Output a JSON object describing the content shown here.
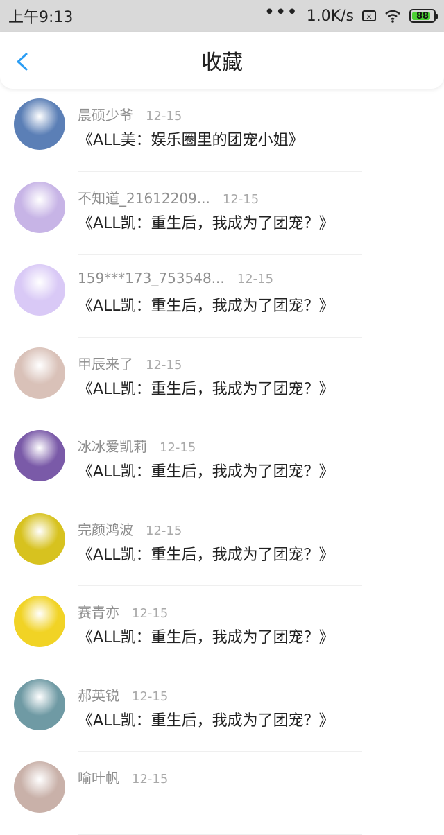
{
  "statusbar": {
    "time": "上午9:13",
    "dots": "•••",
    "speed": "1.0K/s",
    "battery": "88"
  },
  "header": {
    "title": "收藏"
  },
  "items": [
    {
      "name": "晨硕少爷",
      "date": "12-15",
      "book": "《ALL美：娱乐圈里的团宠小姐》",
      "avatar_color": "#5b7fb6"
    },
    {
      "name": "不知道_21612209...",
      "date": "12-15",
      "book": "《ALL凯：重生后，我成为了团宠？》",
      "avatar_color": "#c7b4e6"
    },
    {
      "name": "159***173_753548...",
      "date": "12-15",
      "book": "《ALL凯：重生后，我成为了团宠？》",
      "avatar_color": "#d9c9f6"
    },
    {
      "name": "甲辰来了",
      "date": "12-15",
      "book": "《ALL凯：重生后，我成为了团宠？》",
      "avatar_color": "#d9c1b8"
    },
    {
      "name": "冰冰爱凯莉",
      "date": "12-15",
      "book": "《ALL凯：重生后，我成为了团宠？》",
      "avatar_color": "#7a5aa8"
    },
    {
      "name": "完颜鸿波",
      "date": "12-15",
      "book": "《ALL凯：重生后，我成为了团宠？》",
      "avatar_color": "#d7c21f"
    },
    {
      "name": "赛青亦",
      "date": "12-15",
      "book": "《ALL凯：重生后，我成为了团宠？》",
      "avatar_color": "#f1d325"
    },
    {
      "name": "郝英锐",
      "date": "12-15",
      "book": "《ALL凯：重生后，我成为了团宠？》",
      "avatar_color": "#6f9aa4"
    },
    {
      "name": "喻叶帆",
      "date": "12-15",
      "book": "",
      "avatar_color": "#c9b1a9"
    }
  ],
  "colors": {
    "accent": "#2a9df4",
    "battery_fill": "#4cd134"
  }
}
